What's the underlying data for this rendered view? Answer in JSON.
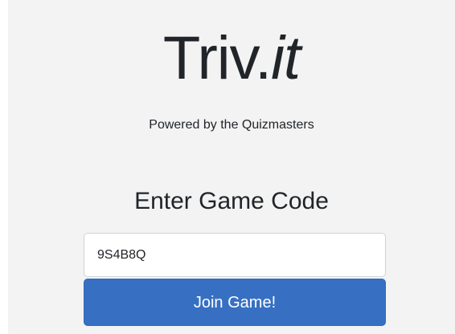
{
  "logo": {
    "main": "Triv.",
    "italic": "it"
  },
  "tagline": "Powered by the Quizmasters",
  "join": {
    "heading": "Enter Game Code",
    "code_value": "9S4B8Q",
    "button_label": "Join Game!"
  },
  "colors": {
    "background": "#f3f3f3",
    "button": "#3770c3",
    "text": "#212529"
  }
}
